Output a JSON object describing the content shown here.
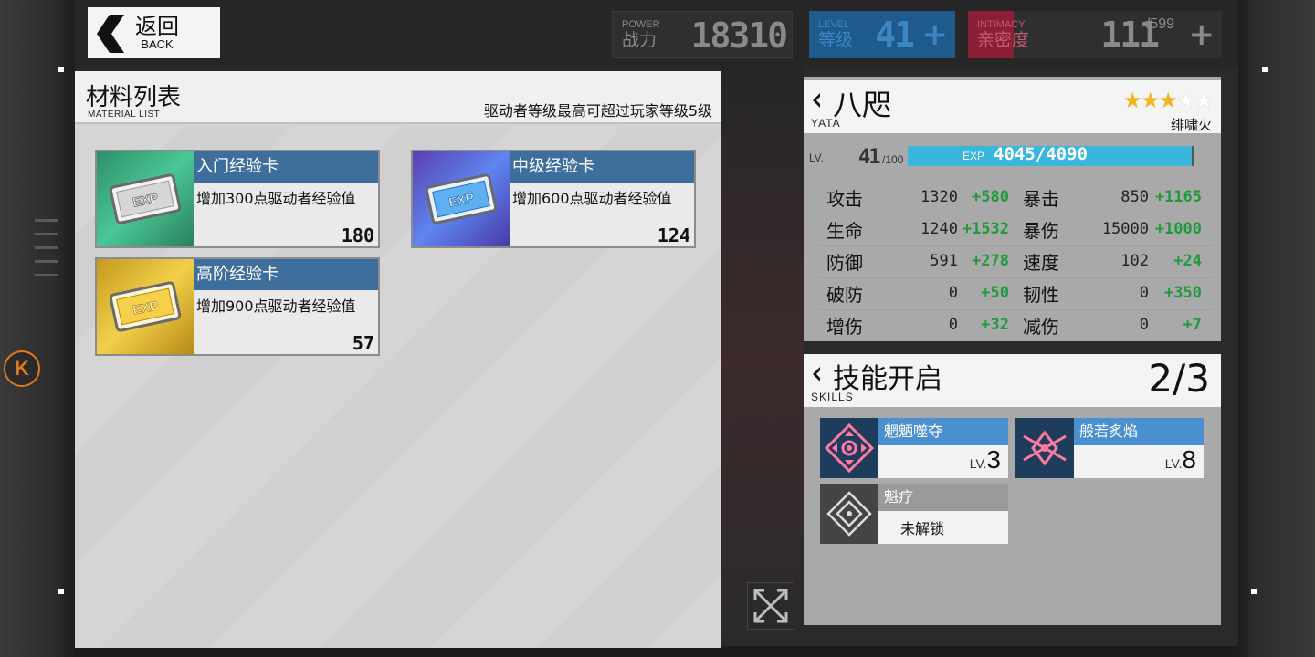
{
  "back": {
    "label_cn": "返回",
    "label_en": "BACK"
  },
  "top_stats": {
    "power": {
      "label_en": "POWER",
      "label_cn": "战力",
      "value": "18310"
    },
    "level": {
      "label_en": "LEVEL",
      "label_cn": "等级",
      "value": "41",
      "plus": "+"
    },
    "intimacy": {
      "label_en": "INTIMACY",
      "label_cn": "亲密度",
      "value": "111",
      "max": "/599",
      "plus": "+"
    }
  },
  "materials": {
    "title": "材料列表",
    "subtitle": "MATERIAL LIST",
    "note": "驱动者等级最高可超过玩家等级5级",
    "items": [
      {
        "name": "入门经验卡",
        "desc": "增加300点驱动者经验值",
        "count": "180",
        "color": "green"
      },
      {
        "name": "中级经验卡",
        "desc": "增加600点驱动者经验值",
        "count": "124",
        "color": "blue"
      },
      {
        "name": "高阶经验卡",
        "desc": "增加900点驱动者经验值",
        "count": "57",
        "color": "gold"
      }
    ],
    "exp_badge": "EXP"
  },
  "character": {
    "name": "八咫",
    "name_en": "YATA",
    "stars_filled": 3,
    "stars_total": 5,
    "star_on": "★★★",
    "star_off": "★★",
    "attribute": "绯啸火",
    "lv_label": "LV.",
    "level": "41",
    "level_max": "/100",
    "exp_label": "EXP",
    "exp_value": "4045/4090",
    "exp_fraction": 0.989,
    "stats": [
      [
        {
          "name": "攻击",
          "base": "1320",
          "bonus": "+580"
        },
        {
          "name": "暴击",
          "base": "850",
          "bonus": "+1165"
        }
      ],
      [
        {
          "name": "生命",
          "base": "1240",
          "bonus": "+1532"
        },
        {
          "name": "暴伤",
          "base": "15000",
          "bonus": "+1000"
        }
      ],
      [
        {
          "name": "防御",
          "base": "591",
          "bonus": "+278"
        },
        {
          "name": "速度",
          "base": "102",
          "bonus": "+24"
        }
      ],
      [
        {
          "name": "破防",
          "base": "0",
          "bonus": "+50"
        },
        {
          "name": "韧性",
          "base": "0",
          "bonus": "+350"
        }
      ],
      [
        {
          "name": "增伤",
          "base": "0",
          "bonus": "+32"
        },
        {
          "name": "减伤",
          "base": "0",
          "bonus": "+7"
        }
      ]
    ]
  },
  "skills": {
    "title": "技能开启",
    "title_en": "SKILLS",
    "count": "2/3",
    "items": [
      {
        "name": "魍魉噬夺",
        "lv_label": "LV.",
        "lv": "3"
      },
      {
        "name": "般若炙焰",
        "lv_label": "LV.",
        "lv": "8"
      },
      {
        "name": "魁疗",
        "locked_text": "未解锁"
      }
    ]
  },
  "colors": {
    "accent_blue": "#3d6e9c",
    "exp_bar": "#38b6dc",
    "bonus_green": "#1f9a3c",
    "star_gold": "#f2b51d",
    "brand_orange": "#e07a1a"
  },
  "icons": {
    "back": "back-arrow-icon",
    "expand": "expand-icon",
    "chevron": "chevron-left-icon",
    "k_badge": "K"
  }
}
